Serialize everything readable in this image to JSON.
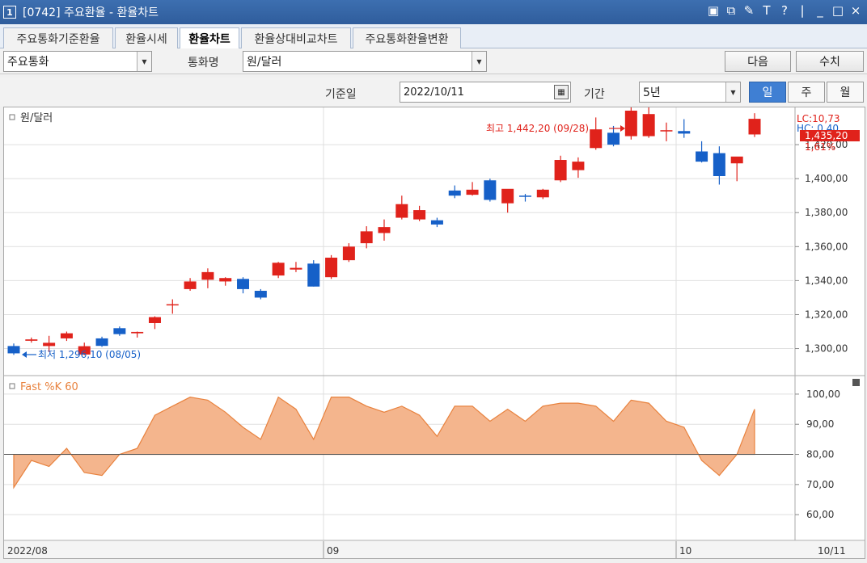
{
  "window": {
    "number": "1",
    "title": "[0742] 주요환율 - 환율차트"
  },
  "tabs": [
    "주요통화기준환율",
    "환율시세",
    "환율차트",
    "환율상대비교차트",
    "주요통화환율변환"
  ],
  "active_tab": 2,
  "toolbar": {
    "group_value": "주요통화",
    "currency_label": "통화명",
    "currency_value": "원/달러",
    "next_label": "다음",
    "manual_label": "수치",
    "date_label": "기준일",
    "date_value": "2022/10/11",
    "period_label": "기간",
    "period_value": "5년",
    "intervals": [
      "일",
      "주",
      "월"
    ],
    "active_interval": 0
  },
  "chart_data": {
    "type": "candlestick",
    "title": "원/달러",
    "x_labels": [
      "2022/08",
      "09",
      "10",
      "10/11"
    ],
    "price_axis": {
      "ticks": [
        "1,420,00",
        "1,400,00",
        "1,380,00",
        "1,360,00",
        "1,340,00",
        "1,320,00",
        "1,300,00"
      ],
      "range": [
        1286,
        1440
      ]
    },
    "high_annotation": "최고 1,442,20 (09/28)",
    "low_annotation": "최저 1,296,10 (08/05)",
    "lc_label": "LC:10,73",
    "hc_label": "HC: 0,40",
    "last_value": "1,435,20",
    "change_pct": "1,61%",
    "candles": [
      {
        "d": "08/01",
        "o": 1301.5,
        "h": 1303,
        "l": 1296.3,
        "c": 1297.2
      },
      {
        "d": "08/02",
        "o": 1304.6,
        "h": 1306.5,
        "l": 1303.5,
        "c": 1305.4
      },
      {
        "d": "08/03",
        "o": 1301.5,
        "h": 1307.5,
        "l": 1298,
        "c": 1303.4
      },
      {
        "d": "08/04",
        "o": 1306,
        "h": 1310,
        "l": 1304.5,
        "c": 1309
      },
      {
        "d": "08/05",
        "o": 1296.5,
        "h": 1303.5,
        "l": 1296.1,
        "c": 1301.4
      },
      {
        "d": "08/08",
        "o": 1306,
        "h": 1307,
        "l": 1301,
        "c": 1301.6
      },
      {
        "d": "08/09",
        "o": 1312,
        "h": 1313,
        "l": 1307.5,
        "c": 1308.5
      },
      {
        "d": "08/10",
        "o": 1309,
        "h": 1310,
        "l": 1306.5,
        "c": 1309.8
      },
      {
        "d": "08/11",
        "o": 1315,
        "h": 1319,
        "l": 1311.5,
        "c": 1318.5
      },
      {
        "d": "08/12",
        "o": 1326,
        "h": 1329,
        "l": 1320.5,
        "c": 1326.1
      },
      {
        "d": "08/16",
        "o": 1335,
        "h": 1341.5,
        "l": 1334,
        "c": 1339.5
      },
      {
        "d": "08/17",
        "o": 1340.5,
        "h": 1347.2,
        "l": 1335.5,
        "c": 1345
      },
      {
        "d": "08/18",
        "o": 1339.5,
        "h": 1342,
        "l": 1337,
        "c": 1341.5
      },
      {
        "d": "08/19",
        "o": 1341,
        "h": 1342,
        "l": 1332.5,
        "c": 1335
      },
      {
        "d": "08/22",
        "o": 1334,
        "h": 1335,
        "l": 1329,
        "c": 1330
      },
      {
        "d": "08/23",
        "o": 1343,
        "h": 1351,
        "l": 1341.5,
        "c": 1350.5
      },
      {
        "d": "08/24",
        "o": 1346.5,
        "h": 1351,
        "l": 1345,
        "c": 1347.5
      },
      {
        "d": "08/25",
        "o": 1350,
        "h": 1352,
        "l": 1336.5,
        "c": 1336.5
      },
      {
        "d": "08/26",
        "o": 1342,
        "h": 1355,
        "l": 1341,
        "c": 1353.5
      },
      {
        "d": "08/29",
        "o": 1352,
        "h": 1362,
        "l": 1351,
        "c": 1360
      },
      {
        "d": "08/30",
        "o": 1362,
        "h": 1372,
        "l": 1359,
        "c": 1369
      },
      {
        "d": "08/31",
        "o": 1368,
        "h": 1376,
        "l": 1363.5,
        "c": 1371.5
      },
      {
        "d": "09/01",
        "o": 1377,
        "h": 1390,
        "l": 1376,
        "c": 1385
      },
      {
        "d": "09/02",
        "o": 1376,
        "h": 1384,
        "l": 1375,
        "c": 1381.5
      },
      {
        "d": "09/05",
        "o": 1375.5,
        "h": 1377,
        "l": 1371.5,
        "c": 1373
      },
      {
        "d": "09/06",
        "o": 1393,
        "h": 1396,
        "l": 1388.5,
        "c": 1390
      },
      {
        "d": "09/07",
        "o": 1390.5,
        "h": 1398,
        "l": 1390,
        "c": 1393.5
      },
      {
        "d": "09/08",
        "o": 1399,
        "h": 1400,
        "l": 1386.5,
        "c": 1387.5
      },
      {
        "d": "09/13",
        "o": 1385.5,
        "h": 1393.5,
        "l": 1380,
        "c": 1394
      },
      {
        "d": "09/14",
        "o": 1390,
        "h": 1391,
        "l": 1386.5,
        "c": 1389.5
      },
      {
        "d": "09/15",
        "o": 1389,
        "h": 1394,
        "l": 1388,
        "c": 1393.5
      },
      {
        "d": "09/16",
        "o": 1399,
        "h": 1413.5,
        "l": 1398,
        "c": 1411
      },
      {
        "d": "09/19",
        "o": 1405,
        "h": 1412.5,
        "l": 1400.5,
        "c": 1410
      },
      {
        "d": "09/21",
        "o": 1418,
        "h": 1436,
        "l": 1417,
        "c": 1429
      },
      {
        "d": "09/22",
        "o": 1427,
        "h": 1431,
        "l": 1419,
        "c": 1420
      },
      {
        "d": "09/23",
        "o": 1425,
        "h": 1442,
        "l": 1423,
        "c": 1440
      },
      {
        "d": "09/26",
        "o": 1425,
        "h": 1442.2,
        "l": 1424,
        "c": 1438
      },
      {
        "d": "09/27",
        "o": 1428,
        "h": 1433,
        "l": 1422,
        "c": 1428.5
      },
      {
        "d": "09/28",
        "o": 1428,
        "h": 1435,
        "l": 1424,
        "c": 1426.5
      },
      {
        "d": "09/30",
        "o": 1416,
        "h": 1422,
        "l": 1409.5,
        "c": 1410
      },
      {
        "d": "10/04",
        "o": 1415,
        "h": 1419,
        "l": 1396.5,
        "c": 1401.5
      },
      {
        "d": "10/05",
        "o": 1409,
        "h": 1412,
        "l": 1398.5,
        "c": 1413
      },
      {
        "d": "10/11",
        "o": 1426,
        "h": 1438.5,
        "l": 1424.5,
        "c": 1435.2
      }
    ],
    "indicator": {
      "name": "Fast %K 60",
      "ticks": [
        "100,00",
        "90,00",
        "80,00",
        "70,00",
        "60,00"
      ],
      "range": [
        52,
        104
      ],
      "baseline": 80,
      "values": [
        69,
        78,
        76,
        82,
        74,
        73,
        80,
        82,
        93,
        96,
        99,
        98,
        94,
        89,
        85,
        99,
        95,
        85,
        99,
        99,
        96,
        94,
        96,
        93,
        86,
        96,
        96,
        91,
        95,
        91,
        96,
        97,
        97,
        96,
        91,
        98,
        97,
        91,
        89,
        78,
        73,
        80,
        95
      ]
    },
    "colors": {
      "up": "#e0221b",
      "down": "#1660c8",
      "area": "#f4b58d",
      "area_line": "#e8823e",
      "grid": "#dfdfdf"
    }
  }
}
